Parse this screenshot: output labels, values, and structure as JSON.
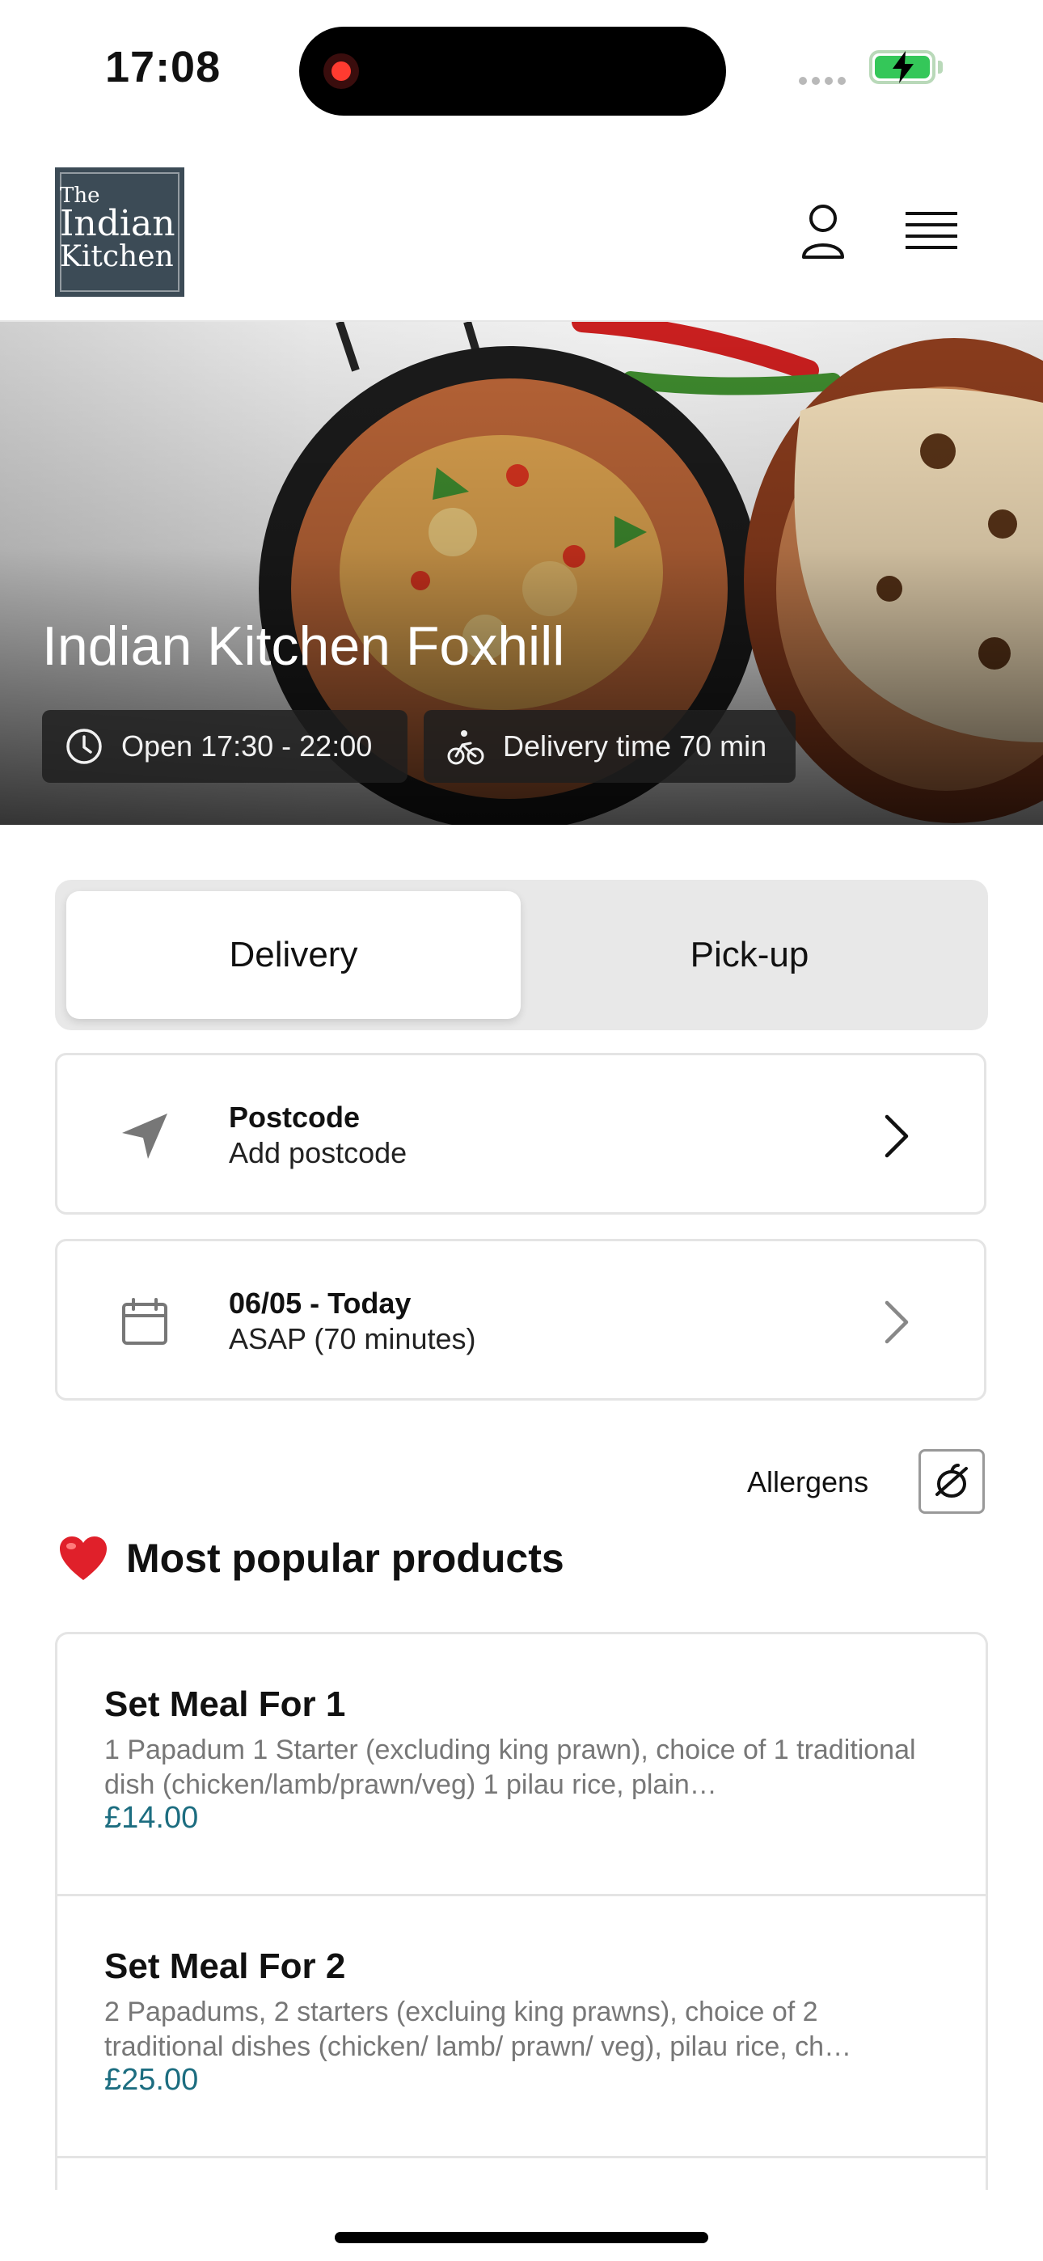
{
  "status_bar": {
    "time": "17:08"
  },
  "header": {
    "logo": {
      "line1": "The",
      "line2": "Indian",
      "line3": "Kitchen"
    }
  },
  "hero": {
    "title": "Indian Kitchen Foxhill",
    "opening_hours": "Open 17:30 - 22:00",
    "delivery_time": "Delivery time 70 min"
  },
  "order_mode": {
    "options": [
      {
        "label": "Delivery",
        "selected": true
      },
      {
        "label": "Pick-up",
        "selected": false
      }
    ]
  },
  "postcode_card": {
    "title": "Postcode",
    "value": "Add postcode"
  },
  "date_card": {
    "title": "06/05 - Today",
    "value": "ASAP (70 minutes)"
  },
  "allergens": {
    "label": "Allergens"
  },
  "popular": {
    "title": "Most popular products",
    "products": [
      {
        "name": "Set Meal For 1",
        "description": "1 Papadum 1 Starter (excluding king prawn), choice of 1 traditional dish (chicken/lamb/prawn/veg) 1 pilau rice, plain…",
        "price": "£14.00"
      },
      {
        "name": "Set Meal For 2",
        "description": "2 Papadums, 2 starters (excluing king prawns), choice of 2 traditional dishes (chicken/ lamb/ prawn/ veg), pilau rice, ch…",
        "price": "£25.00"
      }
    ]
  },
  "colors": {
    "price": "#1c6d80",
    "logo_bg": "#3c4b56",
    "battery": "#34c759"
  }
}
